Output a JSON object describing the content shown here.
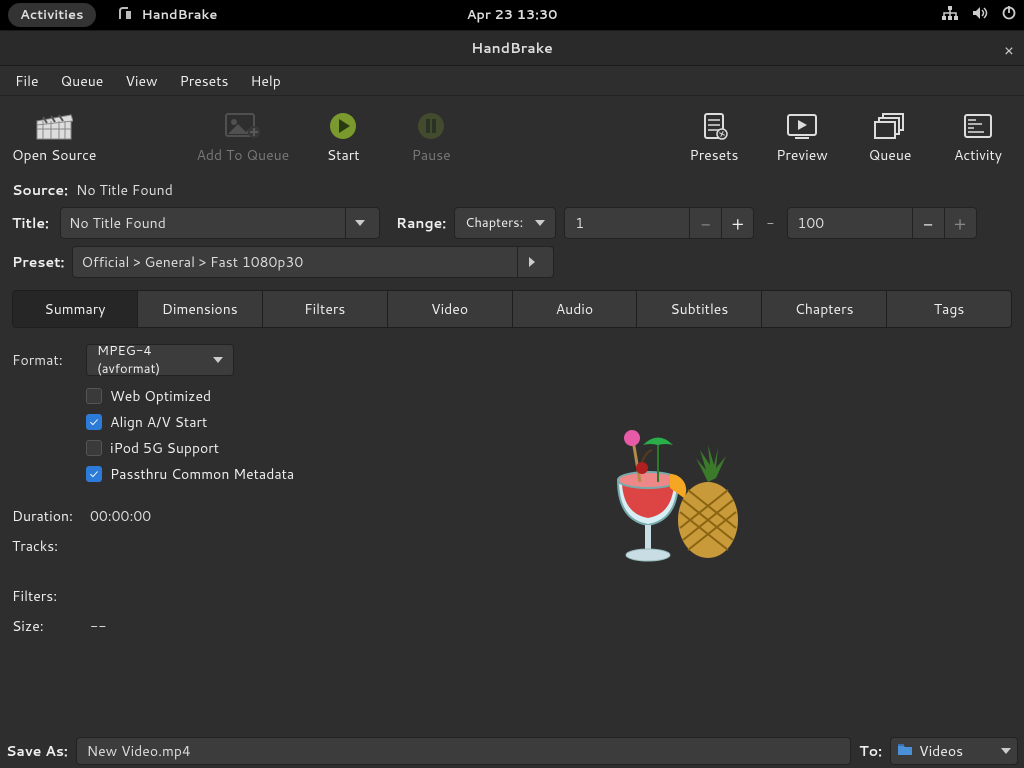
{
  "topbar": {
    "activities": "Activities",
    "appname": "HandBrake",
    "datetime": "Apr 23  13:30"
  },
  "title": "HandBrake",
  "menu": {
    "file": "File",
    "queue": "Queue",
    "view": "View",
    "presets": "Presets",
    "help": "Help"
  },
  "toolbar": {
    "open": "Open Source",
    "addqueue": "Add To Queue",
    "start": "Start",
    "pause": "Pause",
    "presets": "Presets",
    "preview": "Preview",
    "queue": "Queue",
    "activity": "Activity"
  },
  "source": {
    "label": "Source:",
    "value": "No Title Found"
  },
  "titlefld": {
    "label": "Title:",
    "value": "No Title Found"
  },
  "range": {
    "label": "Range:",
    "mode": "Chapters:",
    "from": "1",
    "to": "100"
  },
  "preset": {
    "label": "Preset:",
    "value": "Official > General > Fast 1080p30"
  },
  "tabs": [
    "Summary",
    "Dimensions",
    "Filters",
    "Video",
    "Audio",
    "Subtitles",
    "Chapters",
    "Tags"
  ],
  "summary": {
    "formatlabel": "Format:",
    "format": "MPEG-4 (avformat)",
    "checks": {
      "web": "Web Optimized",
      "align": "Align A/V Start",
      "ipod": "iPod 5G Support",
      "meta": "Passthru Common Metadata"
    },
    "durationlabel": "Duration:",
    "duration": "00:00:00",
    "trackslabel": "Tracks:",
    "filterslabel": "Filters:",
    "sizelabel": "Size:",
    "size": "--"
  },
  "save": {
    "label": "Save As:",
    "value": "New Video.mp4",
    "tolabel": "To:",
    "dest": "Videos"
  }
}
